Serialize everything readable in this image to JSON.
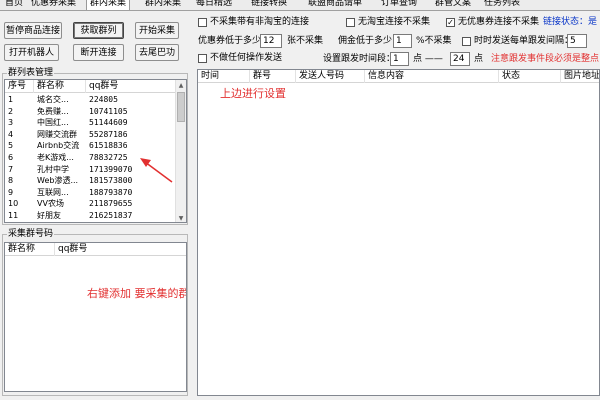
{
  "tabs": [
    {
      "label": "首页",
      "active": false
    },
    {
      "label": "优惠券采集",
      "active": false
    },
    {
      "label": "群内采集",
      "active": true
    },
    {
      "label": "群内采集",
      "active": false
    },
    {
      "label": "每日精选",
      "active": false
    },
    {
      "label": "链接转换",
      "active": false
    },
    {
      "label": "联盟商品请单",
      "active": false
    },
    {
      "label": "订单查询",
      "active": false
    },
    {
      "label": "群管文案",
      "active": false
    },
    {
      "label": "任务列表",
      "active": false
    }
  ],
  "left_buttons": {
    "pause": "暂停商品连接",
    "get_groups": "获取群列",
    "start": "开始采集",
    "open_robot": "打开机器人",
    "disconnect": "断开连接",
    "remove_tail": "去尾巴功"
  },
  "group_list": {
    "title": "群列表管理",
    "columns": [
      "序号",
      "群名称",
      "qq群号"
    ],
    "rows": [
      [
        "1",
        "城名交...",
        "224805"
      ],
      [
        "2",
        "免费赚...",
        "10741105"
      ],
      [
        "3",
        "中国红...",
        "51144609"
      ],
      [
        "4",
        "网赚交流群",
        "55287186"
      ],
      [
        "5",
        "Airbnb交流",
        "61518836"
      ],
      [
        "6",
        "老K游戏...",
        "78832725"
      ],
      [
        "7",
        "孔村中学",
        "171399070"
      ],
      [
        "8",
        "Web渗透...",
        "181573800"
      ],
      [
        "9",
        "互联网...",
        "188793870"
      ],
      [
        "10",
        "VV农场",
        "211879655"
      ],
      [
        "11",
        "好朋友",
        "216251837"
      ]
    ]
  },
  "collect_groups": {
    "title": "采集群号码",
    "columns": [
      "群名称",
      "qq群号"
    ]
  },
  "settings": {
    "no_collect_non_tb": "不采集带有非淘宝的连接",
    "no_collect_tb": "无淘宝连接不采集",
    "no_coupon_no_collect": "无优惠券连接不采集",
    "link_status_label": "链接状态：",
    "link_status_value": "是",
    "coupon_min_label": "优惠券低于多少",
    "coupon_min_value": "12",
    "coupon_min_unit": "张不采集",
    "commission_min_label": "佣金低于多少",
    "commission_min_value": "1",
    "commission_min_unit": "%不采集",
    "timed_send_label": "时时发送每单跟发间隔：",
    "timed_send_value": "5",
    "no_operation_send": "不做任何操作发送",
    "send_interval_label": "设置跟发时间段：",
    "send_interval_from": "1",
    "send_interval_mid": "点 ——",
    "send_interval_to": "24",
    "send_interval_unit": "点",
    "send_interval_note": "注意跟发事件段必须是整点",
    "checked_coupon": true
  },
  "log_table": {
    "columns": [
      "时间",
      "群号",
      "发送人号码",
      "信息内容",
      "状态",
      "图片地址"
    ]
  },
  "annotations": {
    "top_settings": "上边进行设置",
    "right_click_add": "右键添加 要采集的群"
  }
}
